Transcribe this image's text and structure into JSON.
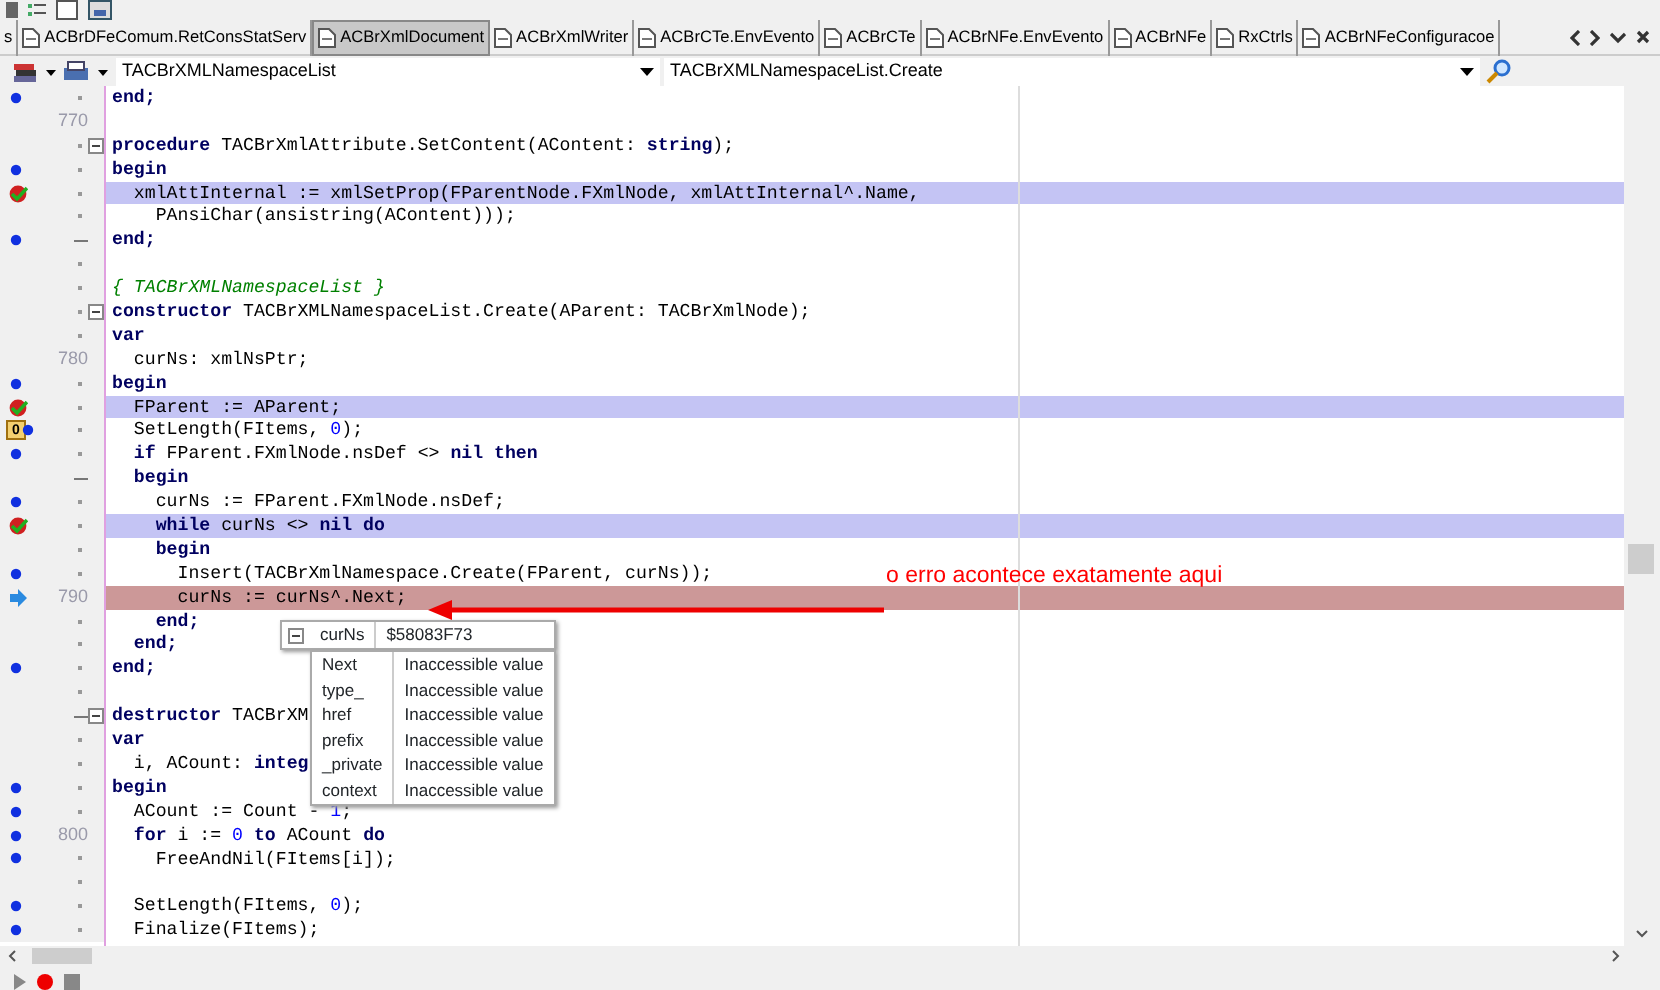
{
  "tabs": [
    {
      "label": "s",
      "selected": false,
      "icon": false
    },
    {
      "label": "ACBrDFeComum.RetConsStatServ",
      "selected": false,
      "icon": true
    },
    {
      "label": "ACBrXmlDocument",
      "selected": true,
      "icon": true
    },
    {
      "label": "ACBrXmlWriter",
      "selected": false,
      "icon": true
    },
    {
      "label": "ACBrCTe.EnvEvento",
      "selected": false,
      "icon": true
    },
    {
      "label": "ACBrCTe",
      "selected": false,
      "icon": true
    },
    {
      "label": "ACBrNFe.EnvEvento",
      "selected": false,
      "icon": true
    },
    {
      "label": "ACBrNFe",
      "selected": false,
      "icon": true
    },
    {
      "label": "RxCtrls",
      "selected": false,
      "icon": true
    },
    {
      "label": "ACBrNFeConfiguracoe",
      "selected": false,
      "icon": true
    }
  ],
  "class_combo": {
    "value": "TACBrXMLNamespaceList"
  },
  "method_combo": {
    "value": "TACBrXMLNamespaceList.Create"
  },
  "lines": [
    {
      "code_dot": true,
      "breakpoint": false,
      "execution_point": false,
      "fold": false,
      "fold_end": false,
      "tokens": [
        {
          "text": "end;",
          "kind": "keyword"
        }
      ]
    },
    {
      "number": "770",
      "code_dot": false,
      "breakpoint": false,
      "execution_point": false,
      "fold": false,
      "fold_end": false
    },
    {
      "code_dot": false,
      "breakpoint": false,
      "execution_point": false,
      "fold": true,
      "fold_end": false,
      "tokens": [
        {
          "text": "procedure",
          "kind": "keyword"
        },
        {
          "text": " TACBrXmlAttribute.SetContent(AContent: "
        },
        {
          "text": "string",
          "kind": "keyword"
        },
        {
          "text": ");"
        }
      ]
    },
    {
      "code_dot": true,
      "breakpoint": false,
      "execution_point": false,
      "fold": false,
      "fold_end": false,
      "tokens": [
        {
          "text": "begin",
          "kind": "keyword"
        }
      ]
    },
    {
      "code_dot": false,
      "breakpoint": true,
      "execution_point": false,
      "fold": false,
      "fold_end": false,
      "tokens": [
        {
          "text": "  xmlAttInternal := xmlSetProp(FParentNode.FXmlNode, xmlAttInternal^.Name,"
        }
      ]
    },
    {
      "code_dot": false,
      "breakpoint": false,
      "execution_point": false,
      "fold": false,
      "fold_end": false,
      "tokens": [
        {
          "text": "    PAnsiChar(ansistring(AContent)));"
        }
      ]
    },
    {
      "code_dot": true,
      "breakpoint": false,
      "execution_point": false,
      "fold": false,
      "fold_end": true,
      "tokens": [
        {
          "text": "end;",
          "kind": "keyword"
        }
      ]
    },
    {
      "code_dot": false,
      "breakpoint": false,
      "execution_point": false,
      "fold": false,
      "fold_end": false
    },
    {
      "code_dot": false,
      "breakpoint": false,
      "execution_point": false,
      "fold": false,
      "fold_end": false,
      "tokens": [
        {
          "text": "{ TACBrXMLNamespaceList }",
          "kind": "comment"
        }
      ]
    },
    {
      "code_dot": false,
      "breakpoint": false,
      "execution_point": false,
      "fold": true,
      "fold_end": false,
      "tokens": [
        {
          "text": "constructor",
          "kind": "keyword"
        },
        {
          "text": " TACBrXMLNamespaceList.Create(AParent: TACBrXmlNode);"
        }
      ]
    },
    {
      "code_dot": false,
      "breakpoint": false,
      "execution_point": false,
      "fold": false,
      "fold_end": false,
      "tokens": [
        {
          "text": "var",
          "kind": "keyword"
        }
      ]
    },
    {
      "number": "780",
      "code_dot": false,
      "breakpoint": false,
      "execution_point": false,
      "fold": false,
      "fold_end": false,
      "tokens": [
        {
          "text": "  curNs: xmlNsPtr;"
        }
      ]
    },
    {
      "code_dot": true,
      "breakpoint": false,
      "execution_point": false,
      "fold": false,
      "fold_end": false,
      "tokens": [
        {
          "text": "begin",
          "kind": "keyword"
        }
      ]
    },
    {
      "code_dot": false,
      "breakpoint": true,
      "execution_point": false,
      "fold": false,
      "fold_end": false,
      "tokens": [
        {
          "text": "  FParent := AParent;"
        }
      ]
    },
    {
      "bookmark": "0",
      "code_dot": true,
      "breakpoint": false,
      "execution_point": false,
      "fold": false,
      "fold_end": false,
      "tokens": [
        {
          "text": "  SetLength(FItems, "
        },
        {
          "text": "0",
          "kind": "number"
        },
        {
          "text": ");"
        }
      ]
    },
    {
      "code_dot": true,
      "breakpoint": false,
      "execution_point": false,
      "fold": false,
      "fold_end": false,
      "tokens": [
        {
          "text": "  if",
          "kind": "keyword"
        },
        {
          "text": " FParent.FXmlNode.nsDef <> "
        },
        {
          "text": "nil",
          "kind": "keyword"
        },
        {
          "text": " then",
          "kind": "keyword"
        }
      ]
    },
    {
      "code_dot": false,
      "breakpoint": false,
      "execution_point": false,
      "fold": false,
      "fold_end": true,
      "tokens": [
        {
          "text": "  begin",
          "kind": "keyword"
        }
      ]
    },
    {
      "code_dot": true,
      "breakpoint": false,
      "execution_point": false,
      "fold": false,
      "fold_end": false,
      "tokens": [
        {
          "text": "    curNs := FParent.FXmlNode.nsDef;"
        }
      ]
    },
    {
      "code_dot": false,
      "breakpoint": true,
      "execution_point": false,
      "fold": false,
      "fold_end": false,
      "tokens": [
        {
          "text": "    while",
          "kind": "keyword"
        },
        {
          "text": " curNs <> "
        },
        {
          "text": "nil",
          "kind": "keyword"
        },
        {
          "text": " do",
          "kind": "keyword"
        }
      ]
    },
    {
      "code_dot": false,
      "breakpoint": false,
      "execution_point": false,
      "fold": false,
      "fold_end": false,
      "tokens": [
        {
          "text": "    begin",
          "kind": "keyword"
        }
      ]
    },
    {
      "code_dot": true,
      "breakpoint": false,
      "execution_point": false,
      "fold": false,
      "fold_end": false,
      "tokens": [
        {
          "text": "      Insert(TACBrXmlNamespace.Create(FParent, curNs));"
        }
      ]
    },
    {
      "number": "790",
      "code_dot": false,
      "breakpoint": false,
      "execution_point": true,
      "fold": false,
      "fold_end": false,
      "tokens": [
        {
          "text": "      curNs := curNs^.Next;"
        }
      ]
    },
    {
      "code_dot": false,
      "breakpoint": false,
      "execution_point": false,
      "fold": false,
      "fold_end": false,
      "tokens": [
        {
          "text": "    end;",
          "kind": "keyword"
        }
      ]
    },
    {
      "code_dot": false,
      "breakpoint": false,
      "execution_point": false,
      "fold": false,
      "fold_end": false,
      "tokens": [
        {
          "text": "  end;",
          "kind": "keyword"
        }
      ]
    },
    {
      "code_dot": true,
      "breakpoint": false,
      "execution_point": false,
      "fold": false,
      "fold_end": false,
      "tokens": [
        {
          "text": "end;",
          "kind": "keyword"
        }
      ]
    },
    {
      "code_dot": false,
      "breakpoint": false,
      "execution_point": false,
      "fold": false,
      "fold_end": false
    },
    {
      "code_dot": false,
      "breakpoint": false,
      "execution_point": false,
      "fold": true,
      "fold_end": true,
      "tokens": [
        {
          "text": "destructor",
          "kind": "keyword"
        },
        {
          "text": " TACBrXM"
        }
      ]
    },
    {
      "code_dot": false,
      "breakpoint": false,
      "execution_point": false,
      "fold": false,
      "fold_end": false,
      "tokens": [
        {
          "text": "var",
          "kind": "keyword"
        }
      ]
    },
    {
      "code_dot": false,
      "breakpoint": false,
      "execution_point": false,
      "fold": false,
      "fold_end": false,
      "tokens": [
        {
          "text": "  i, ACount: "
        },
        {
          "text": "integ",
          "kind": "keyword"
        }
      ]
    },
    {
      "code_dot": true,
      "breakpoint": false,
      "execution_point": false,
      "fold": false,
      "fold_end": false,
      "tokens": [
        {
          "text": "begin",
          "kind": "keyword"
        }
      ]
    },
    {
      "code_dot": true,
      "breakpoint": false,
      "execution_point": false,
      "fold": false,
      "fold_end": false,
      "tokens": [
        {
          "text": "  ACount := Count - "
        },
        {
          "text": "1",
          "kind": "number"
        },
        {
          "text": ";"
        }
      ]
    },
    {
      "number": "800",
      "code_dot": true,
      "breakpoint": false,
      "execution_point": false,
      "fold": false,
      "fold_end": false,
      "tokens": [
        {
          "text": "  for",
          "kind": "keyword"
        },
        {
          "text": " i := "
        },
        {
          "text": "0",
          "kind": "number"
        },
        {
          "text": " to",
          "kind": "keyword"
        },
        {
          "text": " ACount "
        },
        {
          "text": "do",
          "kind": "keyword"
        }
      ]
    },
    {
      "code_dot": true,
      "breakpoint": false,
      "execution_point": false,
      "fold": false,
      "fold_end": false,
      "tokens": [
        {
          "text": "    FreeAndNil(FItems[i]);"
        }
      ]
    },
    {
      "code_dot": false,
      "breakpoint": false,
      "execution_point": false,
      "fold": false,
      "fold_end": false
    },
    {
      "code_dot": true,
      "breakpoint": false,
      "execution_point": false,
      "fold": false,
      "fold_end": false,
      "tokens": [
        {
          "text": "  SetLength(FItems, "
        },
        {
          "text": "0",
          "kind": "number"
        },
        {
          "text": ");"
        }
      ]
    },
    {
      "code_dot": true,
      "breakpoint": false,
      "execution_point": false,
      "fold": false,
      "fold_end": false,
      "tokens": [
        {
          "text": "  Finalize(FItems);"
        }
      ]
    }
  ],
  "watch_popup": {
    "name": "curNs",
    "value": "$58083F73",
    "expanded": true,
    "fields": [
      {
        "name": "Next",
        "value": "Inaccessible value"
      },
      {
        "name": "type_",
        "value": "Inaccessible value"
      },
      {
        "name": "href",
        "value": "Inaccessible value"
      },
      {
        "name": "prefix",
        "value": "Inaccessible value"
      },
      {
        "name": "_private",
        "value": "Inaccessible value"
      },
      {
        "name": "context",
        "value": "Inaccessible value"
      }
    ]
  },
  "annotation": {
    "text": "o erro acontece exatamente aqui"
  }
}
